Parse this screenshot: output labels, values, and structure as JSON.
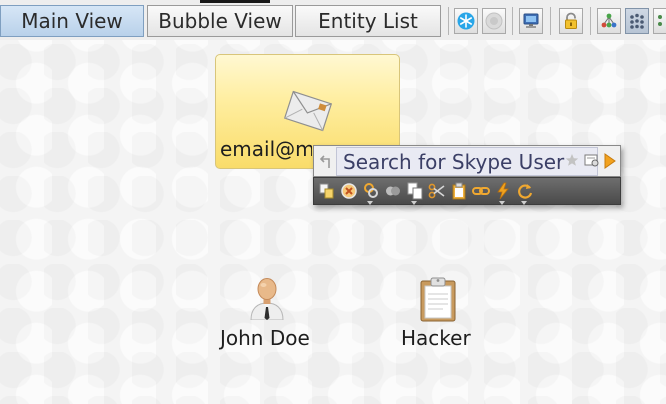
{
  "tabs": [
    {
      "label": "Main View",
      "active": true
    },
    {
      "label": "Bubble View",
      "active": false
    },
    {
      "label": "Entity List",
      "active": false
    }
  ],
  "toolbar_icons": [
    "snowflake-icon",
    "stop-icon",
    "computer-icon",
    "lock-icon",
    "tree-layout-icon",
    "cluster-layout-icon",
    "grid-layout-icon"
  ],
  "graph": {
    "email_entity": {
      "label": "email@mail",
      "icon": "envelope-icon"
    },
    "person_entity": {
      "label": "John Doe",
      "icon": "person-icon"
    },
    "phrase_entity": {
      "label": "Hacker",
      "icon": "clipboard-icon"
    }
  },
  "context_popup": {
    "title": "Search for Skype User",
    "header_icons": [
      "star-icon",
      "detail-view-icon",
      "run-arrow-icon"
    ],
    "actions": [
      "copy-icon",
      "delete-icon",
      "link-icon",
      "merge-icon",
      "paste-icon",
      "cut-icon",
      "clipboard-icon",
      "chain-icon",
      "run-transform-icon",
      "refresh-icon"
    ]
  },
  "colors": {
    "active_tab": "#b9d1ea",
    "entity_card": "#f9dc6a",
    "popup_title_text": "#3b3f66",
    "popup_bar": "#4a4a4a"
  }
}
